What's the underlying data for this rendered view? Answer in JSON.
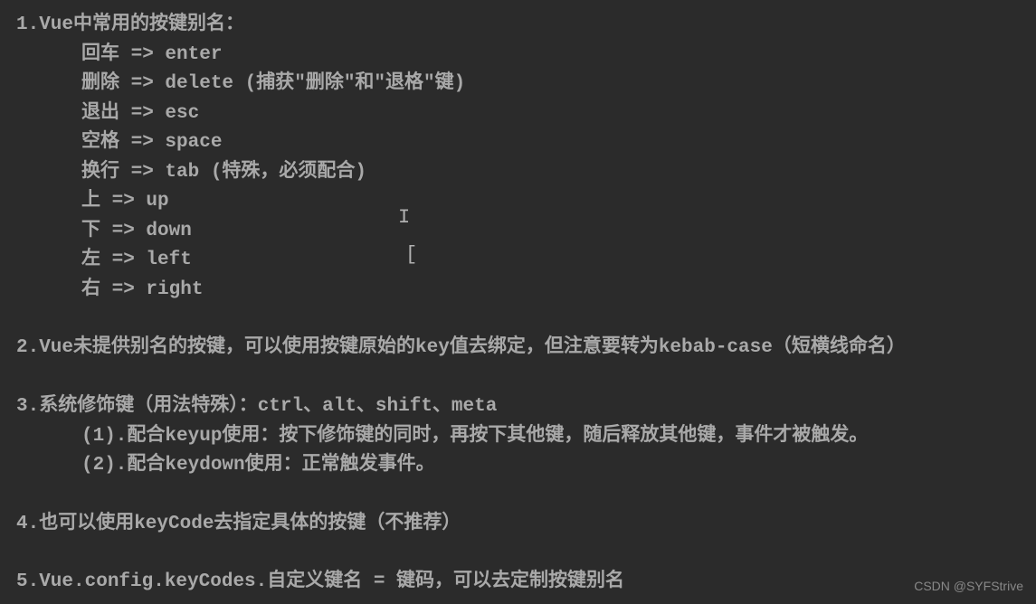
{
  "section1": {
    "title": "1.Vue中常用的按键别名：",
    "items": [
      "回车 => enter",
      "删除 => delete (捕获\"删除\"和\"退格\"键)",
      "退出 => esc",
      "空格 => space",
      "换行 => tab (特殊，必须配合)",
      "上 => up",
      "下 => down",
      "左 => left",
      "右 => right"
    ]
  },
  "section2": {
    "title": "2.Vue未提供别名的按键，可以使用按键原始的key值去绑定，但注意要转为kebab-case（短横线命名）"
  },
  "section3": {
    "title": "3.系统修饰键（用法特殊）：ctrl、alt、shift、meta",
    "sub1": "(1).配合keyup使用：按下修饰键的同时，再按下其他键，随后释放其他键，事件才被触发。",
    "sub2": "(2).配合keydown使用：正常触发事件。"
  },
  "section4": {
    "title": "4.也可以使用keyCode去指定具体的按键（不推荐）"
  },
  "section5": {
    "title": "5.Vue.config.keyCodes.自定义键名 = 键码，可以去定制按键别名"
  },
  "cursors": {
    "c1": "I",
    "c2": "["
  },
  "watermark": "CSDN @SYFStrive"
}
